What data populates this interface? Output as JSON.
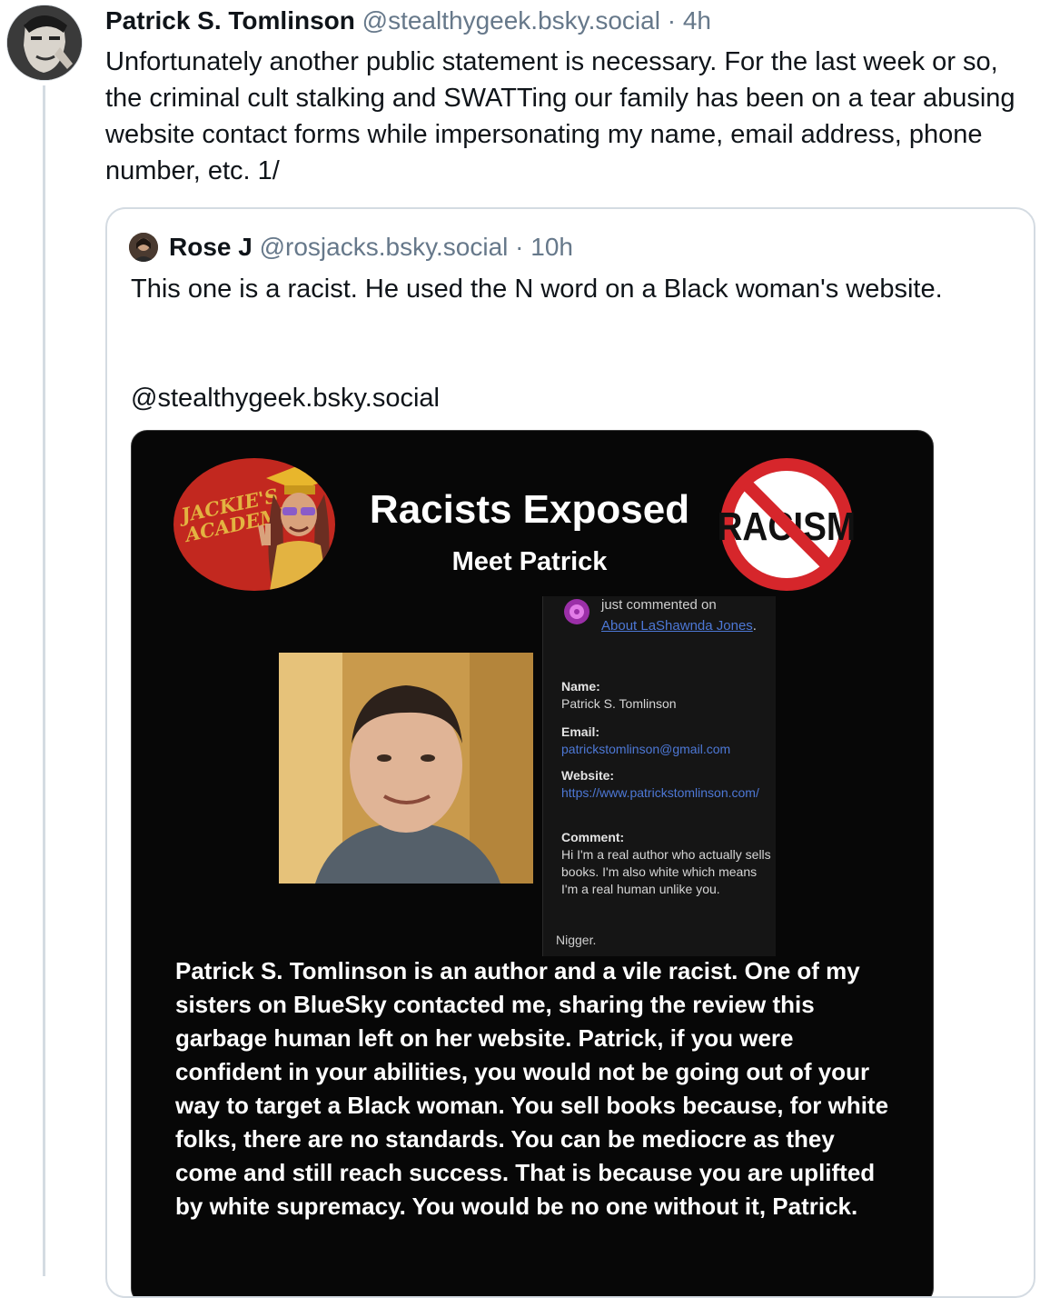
{
  "post": {
    "author_name": "Patrick S. Tomlinson",
    "handle": "@stealthygeek.bsky.social",
    "time": "· 4h",
    "text": "Unfortunately another public statement is necessary. For the last week or so, the criminal cult stalking and SWATTing our family has been on a tear abusing website contact forms while impersonating my name, email address, phone number, etc. 1/"
  },
  "quote": {
    "author_name": "Rose J",
    "handle": "@rosjacks.bsky.social",
    "time": "· 10h",
    "text": "This one is a racist. He used the N word on a Black woman's website.",
    "mention": "@stealthygeek.bsky.social",
    "image": {
      "logo_text": "JACKIE'S ACADEMY",
      "title": "Racists Exposed",
      "subtitle": "Meet Patrick",
      "badge_text": "RACISM",
      "form": {
        "just_commented": "just commented on",
        "link": "About LaShawnda Jones",
        "name_label": "Name:",
        "name_value": "Patrick S. Tomlinson",
        "email_label": "Email:",
        "email_value": "patrickstomlinson@gmail.com",
        "website_label": "Website:",
        "website_value": "https://www.patrickstomlinson.com/",
        "comment_label": "Comment:",
        "comment_value": "Hi I'm a real author who actually sells books. I'm also white which means I'm a real human unlike you.",
        "slur": "Nigger."
      },
      "body_text": "Patrick S. Tomlinson is an author and a vile racist. One of my sisters on BlueSky contacted me, sharing the review this garbage human left on her website. Patrick, if you were confident in your abilities, you would not be going out of your way to target a Black woman. You sell books because, for white folks, there are no standards. You can be mediocre as they come and still reach success. That is because you are uplifted by white supremacy. You would be no one without it, Patrick."
    }
  },
  "colors": {
    "text": "#0f1419",
    "meta": "#66788a",
    "border": "#d4dbe2",
    "link_blue": "#4d78d6",
    "logo_red": "#c2281f",
    "badge_red": "#d6262b"
  }
}
